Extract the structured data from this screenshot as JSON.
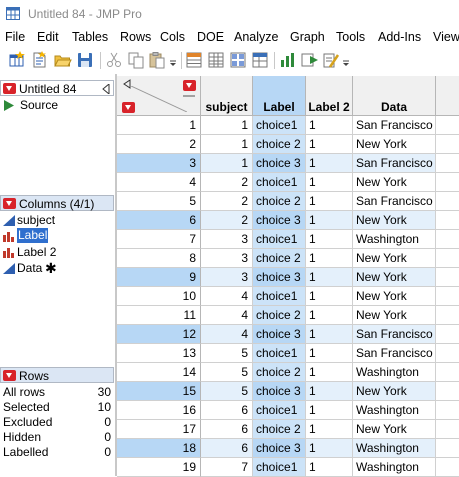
{
  "window": {
    "title": "Untitled 84 - JMP Pro"
  },
  "menu": [
    "File",
    "Edit",
    "Tables",
    "Rows",
    "Cols",
    "DOE",
    "Analyze",
    "Graph",
    "Tools",
    "Add-Ins",
    "View"
  ],
  "table_panel": {
    "name": "Untitled 84",
    "source_label": "Source"
  },
  "columns_panel": {
    "header": "Columns (4/1)",
    "items": [
      {
        "name": "subject",
        "icon": "continuous-icon",
        "selected": false
      },
      {
        "name": "Label",
        "icon": "nominal-icon",
        "selected": true
      },
      {
        "name": "Label 2",
        "icon": "nominal-icon",
        "selected": false
      },
      {
        "name": "Data",
        "icon": "continuous-icon",
        "selected": false,
        "has_formula": true,
        "formula_mark": "✱"
      }
    ]
  },
  "rows_panel": {
    "header": "Rows",
    "stats": [
      {
        "label": "All rows",
        "value": "30"
      },
      {
        "label": "Selected",
        "value": "10"
      },
      {
        "label": "Excluded",
        "value": "0"
      },
      {
        "label": "Hidden",
        "value": "0"
      },
      {
        "label": "Labelled",
        "value": "0"
      }
    ]
  },
  "grid": {
    "columns": [
      "subject",
      "Label",
      "Label 2",
      "Data"
    ],
    "selected_column": "Label",
    "rows": [
      {
        "n": "1",
        "subject": "1",
        "label": "choice1",
        "label2": "1",
        "data": "San Francisco",
        "selected": false
      },
      {
        "n": "2",
        "subject": "1",
        "label": "choice 2",
        "label2": "1",
        "data": "New York",
        "selected": false
      },
      {
        "n": "3",
        "subject": "1",
        "label": "choice 3",
        "label2": "1",
        "data": "San Francisco",
        "selected": true
      },
      {
        "n": "4",
        "subject": "2",
        "label": "choice1",
        "label2": "1",
        "data": "New York",
        "selected": false
      },
      {
        "n": "5",
        "subject": "2",
        "label": "choice 2",
        "label2": "1",
        "data": "San Francisco",
        "selected": false
      },
      {
        "n": "6",
        "subject": "2",
        "label": "choice 3",
        "label2": "1",
        "data": "New York",
        "selected": true
      },
      {
        "n": "7",
        "subject": "3",
        "label": "choice1",
        "label2": "1",
        "data": "Washington",
        "selected": false
      },
      {
        "n": "8",
        "subject": "3",
        "label": "choice 2",
        "label2": "1",
        "data": "New York",
        "selected": false
      },
      {
        "n": "9",
        "subject": "3",
        "label": "choice 3",
        "label2": "1",
        "data": "New York",
        "selected": true
      },
      {
        "n": "10",
        "subject": "4",
        "label": "choice1",
        "label2": "1",
        "data": "New York",
        "selected": false
      },
      {
        "n": "11",
        "subject": "4",
        "label": "choice 2",
        "label2": "1",
        "data": "New York",
        "selected": false
      },
      {
        "n": "12",
        "subject": "4",
        "label": "choice 3",
        "label2": "1",
        "data": "San Francisco",
        "selected": true
      },
      {
        "n": "13",
        "subject": "5",
        "label": "choice1",
        "label2": "1",
        "data": "San Francisco",
        "selected": false
      },
      {
        "n": "14",
        "subject": "5",
        "label": "choice 2",
        "label2": "1",
        "data": "Washington",
        "selected": false
      },
      {
        "n": "15",
        "subject": "5",
        "label": "choice 3",
        "label2": "1",
        "data": "New York",
        "selected": true
      },
      {
        "n": "16",
        "subject": "6",
        "label": "choice1",
        "label2": "1",
        "data": "Washington",
        "selected": false
      },
      {
        "n": "17",
        "subject": "6",
        "label": "choice 2",
        "label2": "1",
        "data": "New York",
        "selected": false
      },
      {
        "n": "18",
        "subject": "6",
        "label": "choice 3",
        "label2": "1",
        "data": "Washington",
        "selected": true
      },
      {
        "n": "19",
        "subject": "7",
        "label": "choice1",
        "label2": "1",
        "data": "Washington",
        "selected": false
      }
    ]
  },
  "colors": {
    "selection": "#b7d7f5",
    "red_triangle": "#d8232a",
    "panel_header": "#dbe6f4",
    "continuous_icon": "#2e5fb0",
    "nominal_icon": "#c0392b"
  }
}
